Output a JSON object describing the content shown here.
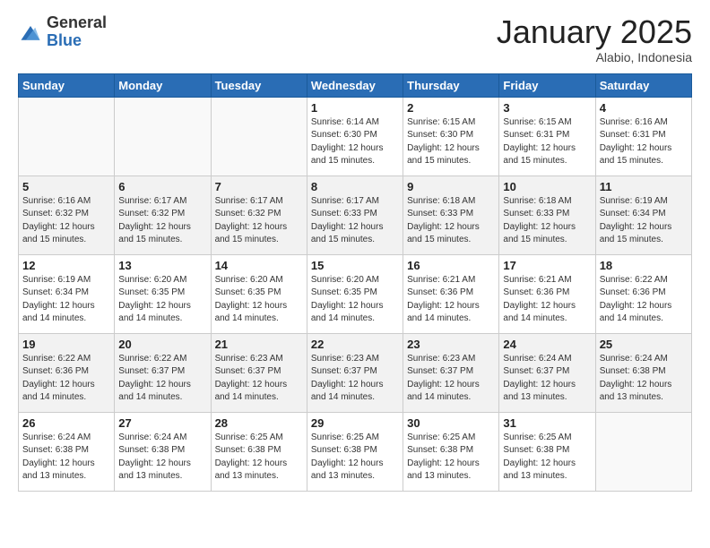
{
  "logo": {
    "general": "General",
    "blue": "Blue"
  },
  "header": {
    "month": "January 2025",
    "location": "Alabio, Indonesia"
  },
  "weekdays": [
    "Sunday",
    "Monday",
    "Tuesday",
    "Wednesday",
    "Thursday",
    "Friday",
    "Saturday"
  ],
  "weeks": [
    [
      {
        "day": "",
        "info": ""
      },
      {
        "day": "",
        "info": ""
      },
      {
        "day": "",
        "info": ""
      },
      {
        "day": "1",
        "info": "Sunrise: 6:14 AM\nSunset: 6:30 PM\nDaylight: 12 hours\nand 15 minutes."
      },
      {
        "day": "2",
        "info": "Sunrise: 6:15 AM\nSunset: 6:30 PM\nDaylight: 12 hours\nand 15 minutes."
      },
      {
        "day": "3",
        "info": "Sunrise: 6:15 AM\nSunset: 6:31 PM\nDaylight: 12 hours\nand 15 minutes."
      },
      {
        "day": "4",
        "info": "Sunrise: 6:16 AM\nSunset: 6:31 PM\nDaylight: 12 hours\nand 15 minutes."
      }
    ],
    [
      {
        "day": "5",
        "info": "Sunrise: 6:16 AM\nSunset: 6:32 PM\nDaylight: 12 hours\nand 15 minutes."
      },
      {
        "day": "6",
        "info": "Sunrise: 6:17 AM\nSunset: 6:32 PM\nDaylight: 12 hours\nand 15 minutes."
      },
      {
        "day": "7",
        "info": "Sunrise: 6:17 AM\nSunset: 6:32 PM\nDaylight: 12 hours\nand 15 minutes."
      },
      {
        "day": "8",
        "info": "Sunrise: 6:17 AM\nSunset: 6:33 PM\nDaylight: 12 hours\nand 15 minutes."
      },
      {
        "day": "9",
        "info": "Sunrise: 6:18 AM\nSunset: 6:33 PM\nDaylight: 12 hours\nand 15 minutes."
      },
      {
        "day": "10",
        "info": "Sunrise: 6:18 AM\nSunset: 6:33 PM\nDaylight: 12 hours\nand 15 minutes."
      },
      {
        "day": "11",
        "info": "Sunrise: 6:19 AM\nSunset: 6:34 PM\nDaylight: 12 hours\nand 15 minutes."
      }
    ],
    [
      {
        "day": "12",
        "info": "Sunrise: 6:19 AM\nSunset: 6:34 PM\nDaylight: 12 hours\nand 14 minutes."
      },
      {
        "day": "13",
        "info": "Sunrise: 6:20 AM\nSunset: 6:35 PM\nDaylight: 12 hours\nand 14 minutes."
      },
      {
        "day": "14",
        "info": "Sunrise: 6:20 AM\nSunset: 6:35 PM\nDaylight: 12 hours\nand 14 minutes."
      },
      {
        "day": "15",
        "info": "Sunrise: 6:20 AM\nSunset: 6:35 PM\nDaylight: 12 hours\nand 14 minutes."
      },
      {
        "day": "16",
        "info": "Sunrise: 6:21 AM\nSunset: 6:36 PM\nDaylight: 12 hours\nand 14 minutes."
      },
      {
        "day": "17",
        "info": "Sunrise: 6:21 AM\nSunset: 6:36 PM\nDaylight: 12 hours\nand 14 minutes."
      },
      {
        "day": "18",
        "info": "Sunrise: 6:22 AM\nSunset: 6:36 PM\nDaylight: 12 hours\nand 14 minutes."
      }
    ],
    [
      {
        "day": "19",
        "info": "Sunrise: 6:22 AM\nSunset: 6:36 PM\nDaylight: 12 hours\nand 14 minutes."
      },
      {
        "day": "20",
        "info": "Sunrise: 6:22 AM\nSunset: 6:37 PM\nDaylight: 12 hours\nand 14 minutes."
      },
      {
        "day": "21",
        "info": "Sunrise: 6:23 AM\nSunset: 6:37 PM\nDaylight: 12 hours\nand 14 minutes."
      },
      {
        "day": "22",
        "info": "Sunrise: 6:23 AM\nSunset: 6:37 PM\nDaylight: 12 hours\nand 14 minutes."
      },
      {
        "day": "23",
        "info": "Sunrise: 6:23 AM\nSunset: 6:37 PM\nDaylight: 12 hours\nand 14 minutes."
      },
      {
        "day": "24",
        "info": "Sunrise: 6:24 AM\nSunset: 6:37 PM\nDaylight: 12 hours\nand 13 minutes."
      },
      {
        "day": "25",
        "info": "Sunrise: 6:24 AM\nSunset: 6:38 PM\nDaylight: 12 hours\nand 13 minutes."
      }
    ],
    [
      {
        "day": "26",
        "info": "Sunrise: 6:24 AM\nSunset: 6:38 PM\nDaylight: 12 hours\nand 13 minutes."
      },
      {
        "day": "27",
        "info": "Sunrise: 6:24 AM\nSunset: 6:38 PM\nDaylight: 12 hours\nand 13 minutes."
      },
      {
        "day": "28",
        "info": "Sunrise: 6:25 AM\nSunset: 6:38 PM\nDaylight: 12 hours\nand 13 minutes."
      },
      {
        "day": "29",
        "info": "Sunrise: 6:25 AM\nSunset: 6:38 PM\nDaylight: 12 hours\nand 13 minutes."
      },
      {
        "day": "30",
        "info": "Sunrise: 6:25 AM\nSunset: 6:38 PM\nDaylight: 12 hours\nand 13 minutes."
      },
      {
        "day": "31",
        "info": "Sunrise: 6:25 AM\nSunset: 6:38 PM\nDaylight: 12 hours\nand 13 minutes."
      },
      {
        "day": "",
        "info": ""
      }
    ]
  ],
  "shaded_rows": [
    1,
    3
  ]
}
